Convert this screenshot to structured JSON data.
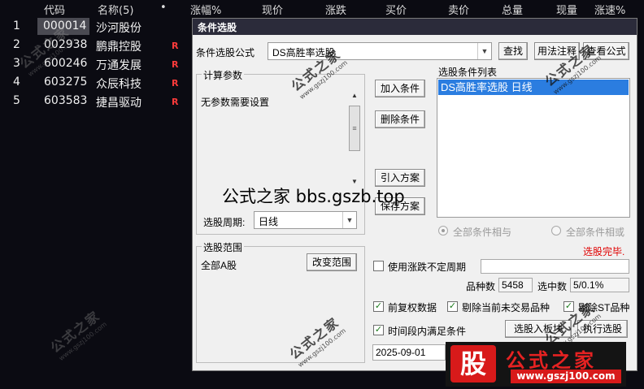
{
  "grid": {
    "headers": {
      "code": "代码",
      "name": "名称(5)",
      "dot": "•",
      "change_pct": "涨幅%",
      "price": "现价",
      "change": "涨跌",
      "bid": "买价",
      "ask": "卖价",
      "volume": "总量",
      "cur_vol": "现量",
      "speed": "涨速%"
    },
    "rows": [
      {
        "idx": "1",
        "code": "000014",
        "name": "沙河股份",
        "flag": ""
      },
      {
        "idx": "2",
        "code": "002938",
        "name": "鹏鼎控股",
        "flag": "R"
      },
      {
        "idx": "3",
        "code": "600246",
        "name": "万通发展",
        "flag": "R"
      },
      {
        "idx": "4",
        "code": "603275",
        "name": "众辰科技",
        "flag": "R"
      },
      {
        "idx": "5",
        "code": "603583",
        "name": "捷昌驱动",
        "flag": "R"
      }
    ]
  },
  "dialog": {
    "title": "条件选股",
    "formula_label": "条件选股公式",
    "formula_value": "DS高胜率选股",
    "find_button": "查找",
    "usage_button": "用法注释",
    "view_formula_button": "查看公式",
    "params_group": "计算参数",
    "params_text": "无参数需要设置",
    "period_label": "选股周期:",
    "period_value": "日线",
    "add_condition": "加入条件",
    "delete_condition": "删除条件",
    "import_plan": "引入方案",
    "save_plan": "保存方案",
    "conditions_list_label": "选股条件列表",
    "conditions": [
      "DS高胜率选股  日线"
    ],
    "radio_and": "全部条件相与",
    "radio_or": "全部条件相或",
    "status": "选股完毕.",
    "range_group": "选股范围",
    "range_value": "全部A股",
    "change_range": "改变范围",
    "use_uncertain_period": "使用涨跌不定周期",
    "variety_count_label": "品种数",
    "variety_count": "5458",
    "selected_label": "选中数",
    "selected_value": "5/0.1%",
    "pre_adjusted": "前复权数据",
    "remove_untraded": "剔除当前未交易品种",
    "remove_st": "剔除ST品种",
    "time_range_check": "时间段内满足条件",
    "to_board": "选股入板块",
    "execute": "执行选股",
    "start_date": "2025-09-01"
  },
  "overlay": "公式之家 bbs.gszb.top",
  "watermark": {
    "name": "公式之家",
    "url": "www.gszj100.com"
  },
  "logo": {
    "badge": "股",
    "name": "公式之家",
    "url": "www.gszj100.com"
  },
  "colors": {
    "flag_red": "#ff3b3b",
    "selection_blue": "#2b7de0",
    "status_red": "#e00000"
  }
}
